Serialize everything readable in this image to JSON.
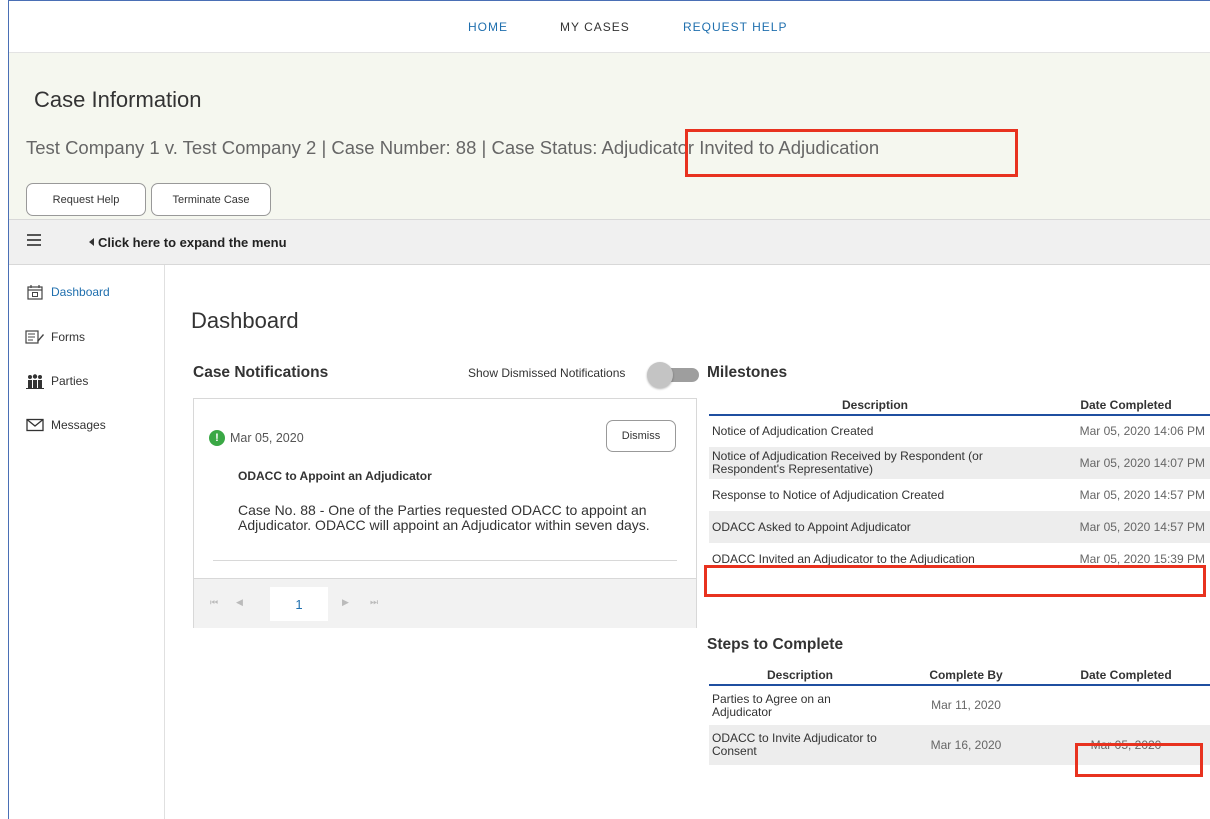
{
  "nav": {
    "home": "HOME",
    "my_cases": "MY CASES",
    "request_help": "REQUEST HELP"
  },
  "case": {
    "title": "Case Information",
    "subline_prefix": "Test Company 1 v. Test Company 2 | Case Number: 88 | Case Status: ",
    "status": "Adjudicator Invited to Adjudication",
    "request_help_button": "Request Help",
    "terminate_button": "Terminate Case"
  },
  "menu": {
    "expand_text": "Click here to expand the menu"
  },
  "sidebar": {
    "items": [
      {
        "label": "Dashboard",
        "icon": "calendar-icon"
      },
      {
        "label": "Forms",
        "icon": "forms-icon"
      },
      {
        "label": "Parties",
        "icon": "parties-icon"
      },
      {
        "label": "Messages",
        "icon": "envelope-icon"
      }
    ]
  },
  "dashboard": {
    "title": "Dashboard",
    "notifications": {
      "heading": "Case Notifications",
      "show_dismissed_label": "Show Dismissed Notifications",
      "show_dismissed_on": false,
      "item": {
        "date": "Mar 05, 2020",
        "dismiss_label": "Dismiss",
        "title": "ODACC to Appoint an Adjudicator",
        "body": "Case No. 88 - One of the Parties requested ODACC to appoint an Adjudicator. ODACC will appoint an Adjudicator within seven days."
      },
      "pager": {
        "current_page": "1",
        "first": "⏮",
        "prev": "◀",
        "next": "▶",
        "last": "⏭"
      }
    },
    "milestones": {
      "heading": "Milestones",
      "columns": [
        "Description",
        "Date Completed"
      ],
      "rows": [
        {
          "description": "Notice of Adjudication Created",
          "date": "Mar 05, 2020 14:06 PM"
        },
        {
          "description": "Notice of Adjudication Received by Respondent (or Respondent's Representative)",
          "date": "Mar 05, 2020 14:07 PM"
        },
        {
          "description": "Response to Notice of Adjudication Created",
          "date": "Mar 05, 2020 14:57 PM"
        },
        {
          "description": "ODACC Asked to Appoint Adjudicator",
          "date": "Mar 05, 2020 14:57 PM"
        },
        {
          "description": "ODACC Invited an Adjudicator to the Adjudication",
          "date": "Mar 05, 2020 15:39 PM"
        }
      ]
    },
    "steps": {
      "heading": "Steps to Complete",
      "columns": [
        "Description",
        "Complete By",
        "Date Completed"
      ],
      "rows": [
        {
          "description": "Parties to Agree on an Adjudicator",
          "complete_by": "Mar 11, 2020",
          "date_completed": ""
        },
        {
          "description": "ODACC to Invite Adjudicator to Consent",
          "complete_by": "Mar 16, 2020",
          "date_completed": "Mar 05, 2020"
        }
      ]
    }
  },
  "colors": {
    "accent": "#1f6fae",
    "highlight": "#e8321f",
    "header_bg": "#f5f7ef",
    "success": "#3aa845"
  }
}
